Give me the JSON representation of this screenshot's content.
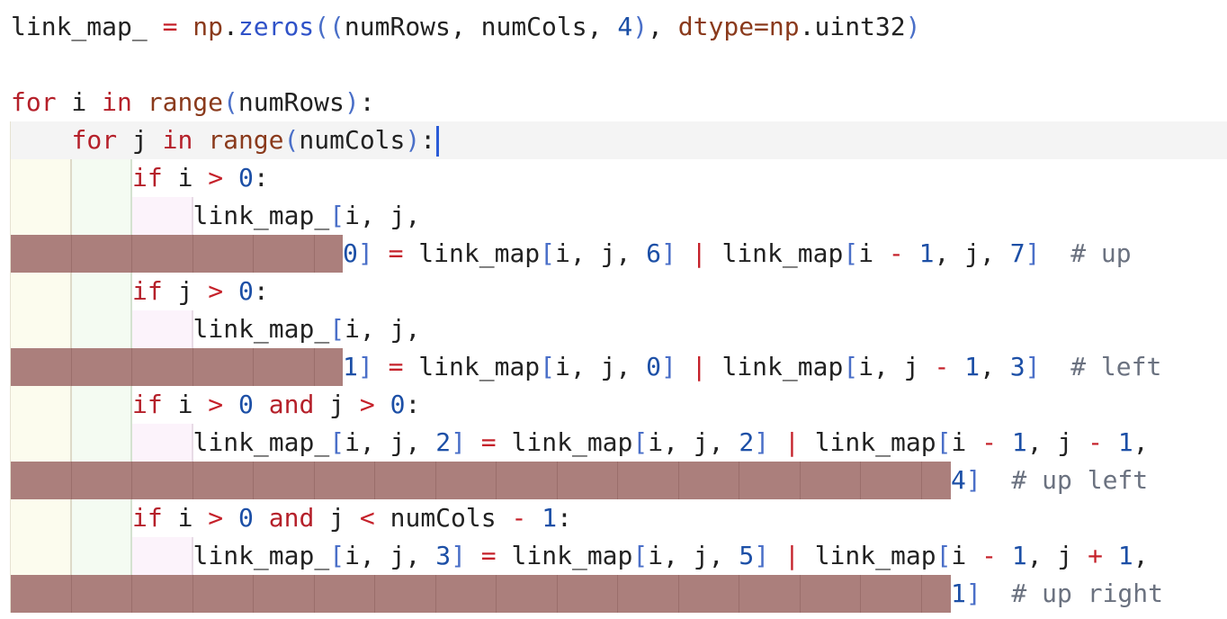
{
  "editor": {
    "lines": [
      {
        "id": "partial-top",
        "tokens": [
          {
            "t": "link_map_",
            "c": "tx"
          },
          {
            "t": " = ",
            "c": "op"
          },
          {
            "t": "np",
            "c": "mod"
          },
          {
            "t": ".",
            "c": "tx"
          },
          {
            "t": "zeros",
            "c": "attr"
          },
          {
            "t": "((",
            "c": "pn"
          },
          {
            "t": "numRows, numCols, ",
            "c": "tx"
          },
          {
            "t": "4",
            "c": "num"
          },
          {
            "t": ")",
            "c": "pn"
          },
          {
            "t": ", ",
            "c": "tx"
          },
          {
            "t": "dtype=np",
            "c": "mod"
          },
          {
            "t": ".uint32",
            "c": "tx"
          },
          {
            "t": ")",
            "c": "pn"
          }
        ]
      },
      {
        "id": "blank",
        "tokens": []
      },
      {
        "id": "for-i",
        "tokens": [
          {
            "t": "for",
            "c": "kw"
          },
          {
            "t": " i ",
            "c": "tx"
          },
          {
            "t": "in",
            "c": "kw"
          },
          {
            "t": " ",
            "c": "tx"
          },
          {
            "t": "range",
            "c": "fn"
          },
          {
            "t": "(",
            "c": "pn"
          },
          {
            "t": "numRows",
            "c": "tx"
          },
          {
            "t": ")",
            "c": "pn"
          },
          {
            "t": ":",
            "c": "tx"
          }
        ]
      },
      {
        "id": "for-j",
        "tokens": [
          {
            "t": "for",
            "c": "kw"
          },
          {
            "t": " j ",
            "c": "tx"
          },
          {
            "t": "in",
            "c": "kw"
          },
          {
            "t": " ",
            "c": "tx"
          },
          {
            "t": "range",
            "c": "fn"
          },
          {
            "t": "(",
            "c": "pn"
          },
          {
            "t": "numCols",
            "c": "tx"
          },
          {
            "t": ")",
            "c": "pn"
          },
          {
            "t": ":",
            "c": "tx"
          }
        ]
      },
      {
        "id": "if-i",
        "tokens": [
          {
            "t": "if",
            "c": "kw"
          },
          {
            "t": " i ",
            "c": "tx"
          },
          {
            "t": ">",
            "c": "op"
          },
          {
            "t": " ",
            "c": "tx"
          },
          {
            "t": "0",
            "c": "num"
          },
          {
            "t": ":",
            "c": "tx"
          }
        ]
      },
      {
        "id": "up-a",
        "tokens": [
          {
            "t": "link_map_",
            "c": "tx"
          },
          {
            "t": "[",
            "c": "pn"
          },
          {
            "t": "i, j,",
            "c": "tx"
          }
        ]
      },
      {
        "id": "up-b",
        "tokens": [
          {
            "t": "0",
            "c": "num"
          },
          {
            "t": "]",
            "c": "pn"
          },
          {
            "t": " = ",
            "c": "op"
          },
          {
            "t": "link_map",
            "c": "tx"
          },
          {
            "t": "[",
            "c": "pn"
          },
          {
            "t": "i, j, ",
            "c": "tx"
          },
          {
            "t": "6",
            "c": "num"
          },
          {
            "t": "]",
            "c": "pn"
          },
          {
            "t": " | ",
            "c": "op"
          },
          {
            "t": "link_map",
            "c": "tx"
          },
          {
            "t": "[",
            "c": "pn"
          },
          {
            "t": "i ",
            "c": "tx"
          },
          {
            "t": "-",
            "c": "op"
          },
          {
            "t": " ",
            "c": "tx"
          },
          {
            "t": "1",
            "c": "num"
          },
          {
            "t": ", j, ",
            "c": "tx"
          },
          {
            "t": "7",
            "c": "num"
          },
          {
            "t": "]",
            "c": "pn"
          },
          {
            "t": "  # up",
            "c": "cm"
          }
        ]
      },
      {
        "id": "if-j",
        "tokens": [
          {
            "t": "if",
            "c": "kw"
          },
          {
            "t": " j ",
            "c": "tx"
          },
          {
            "t": ">",
            "c": "op"
          },
          {
            "t": " ",
            "c": "tx"
          },
          {
            "t": "0",
            "c": "num"
          },
          {
            "t": ":",
            "c": "tx"
          }
        ]
      },
      {
        "id": "left-a",
        "tokens": [
          {
            "t": "link_map_",
            "c": "tx"
          },
          {
            "t": "[",
            "c": "pn"
          },
          {
            "t": "i, j,",
            "c": "tx"
          }
        ]
      },
      {
        "id": "left-b",
        "tokens": [
          {
            "t": "1",
            "c": "num"
          },
          {
            "t": "]",
            "c": "pn"
          },
          {
            "t": " = ",
            "c": "op"
          },
          {
            "t": "link_map",
            "c": "tx"
          },
          {
            "t": "[",
            "c": "pn"
          },
          {
            "t": "i, j, ",
            "c": "tx"
          },
          {
            "t": "0",
            "c": "num"
          },
          {
            "t": "]",
            "c": "pn"
          },
          {
            "t": " | ",
            "c": "op"
          },
          {
            "t": "link_map",
            "c": "tx"
          },
          {
            "t": "[",
            "c": "pn"
          },
          {
            "t": "i, j ",
            "c": "tx"
          },
          {
            "t": "-",
            "c": "op"
          },
          {
            "t": " ",
            "c": "tx"
          },
          {
            "t": "1",
            "c": "num"
          },
          {
            "t": ", ",
            "c": "tx"
          },
          {
            "t": "3",
            "c": "num"
          },
          {
            "t": "]",
            "c": "pn"
          },
          {
            "t": "  # left",
            "c": "cm"
          }
        ]
      },
      {
        "id": "if-ij",
        "tokens": [
          {
            "t": "if",
            "c": "kw"
          },
          {
            "t": " i ",
            "c": "tx"
          },
          {
            "t": ">",
            "c": "op"
          },
          {
            "t": " ",
            "c": "tx"
          },
          {
            "t": "0",
            "c": "num"
          },
          {
            "t": " ",
            "c": "tx"
          },
          {
            "t": "and",
            "c": "kw"
          },
          {
            "t": " j ",
            "c": "tx"
          },
          {
            "t": ">",
            "c": "op"
          },
          {
            "t": " ",
            "c": "tx"
          },
          {
            "t": "0",
            "c": "num"
          },
          {
            "t": ":",
            "c": "tx"
          }
        ]
      },
      {
        "id": "upleft-a",
        "tokens": [
          {
            "t": "link_map_",
            "c": "tx"
          },
          {
            "t": "[",
            "c": "pn"
          },
          {
            "t": "i, j, ",
            "c": "tx"
          },
          {
            "t": "2",
            "c": "num"
          },
          {
            "t": "]",
            "c": "pn"
          },
          {
            "t": " = ",
            "c": "op"
          },
          {
            "t": "link_map",
            "c": "tx"
          },
          {
            "t": "[",
            "c": "pn"
          },
          {
            "t": "i, j, ",
            "c": "tx"
          },
          {
            "t": "2",
            "c": "num"
          },
          {
            "t": "]",
            "c": "pn"
          },
          {
            "t": " | ",
            "c": "op"
          },
          {
            "t": "link_map",
            "c": "tx"
          },
          {
            "t": "[",
            "c": "pn"
          },
          {
            "t": "i ",
            "c": "tx"
          },
          {
            "t": "-",
            "c": "op"
          },
          {
            "t": " ",
            "c": "tx"
          },
          {
            "t": "1",
            "c": "num"
          },
          {
            "t": ", j ",
            "c": "tx"
          },
          {
            "t": "-",
            "c": "op"
          },
          {
            "t": " ",
            "c": "tx"
          },
          {
            "t": "1",
            "c": "num"
          },
          {
            "t": ",",
            "c": "tx"
          }
        ]
      },
      {
        "id": "upleft-b",
        "tokens": [
          {
            "t": "4",
            "c": "num"
          },
          {
            "t": "]",
            "c": "pn"
          },
          {
            "t": "  # up left",
            "c": "cm"
          }
        ]
      },
      {
        "id": "if-ij2",
        "tokens": [
          {
            "t": "if",
            "c": "kw"
          },
          {
            "t": " i ",
            "c": "tx"
          },
          {
            "t": ">",
            "c": "op"
          },
          {
            "t": " ",
            "c": "tx"
          },
          {
            "t": "0",
            "c": "num"
          },
          {
            "t": " ",
            "c": "tx"
          },
          {
            "t": "and",
            "c": "kw"
          },
          {
            "t": " j ",
            "c": "tx"
          },
          {
            "t": "<",
            "c": "op"
          },
          {
            "t": " numCols ",
            "c": "tx"
          },
          {
            "t": "-",
            "c": "op"
          },
          {
            "t": " ",
            "c": "tx"
          },
          {
            "t": "1",
            "c": "num"
          },
          {
            "t": ":",
            "c": "tx"
          }
        ]
      },
      {
        "id": "upright-a",
        "tokens": [
          {
            "t": "link_map_",
            "c": "tx"
          },
          {
            "t": "[",
            "c": "pn"
          },
          {
            "t": "i, j, ",
            "c": "tx"
          },
          {
            "t": "3",
            "c": "num"
          },
          {
            "t": "]",
            "c": "pn"
          },
          {
            "t": " = ",
            "c": "op"
          },
          {
            "t": "link_map",
            "c": "tx"
          },
          {
            "t": "[",
            "c": "pn"
          },
          {
            "t": "i, j, ",
            "c": "tx"
          },
          {
            "t": "5",
            "c": "num"
          },
          {
            "t": "]",
            "c": "pn"
          },
          {
            "t": " | ",
            "c": "op"
          },
          {
            "t": "link_map",
            "c": "tx"
          },
          {
            "t": "[",
            "c": "pn"
          },
          {
            "t": "i ",
            "c": "tx"
          },
          {
            "t": "-",
            "c": "op"
          },
          {
            "t": " ",
            "c": "tx"
          },
          {
            "t": "1",
            "c": "num"
          },
          {
            "t": ", j ",
            "c": "tx"
          },
          {
            "t": "+",
            "c": "op"
          },
          {
            "t": " ",
            "c": "tx"
          },
          {
            "t": "1",
            "c": "num"
          },
          {
            "t": ",",
            "c": "tx"
          }
        ]
      },
      {
        "id": "upright-b",
        "tokens": [
          {
            "t": "1",
            "c": "num"
          },
          {
            "t": "]",
            "c": "pn"
          },
          {
            "t": "  # up right",
            "c": "cm"
          }
        ]
      }
    ]
  }
}
